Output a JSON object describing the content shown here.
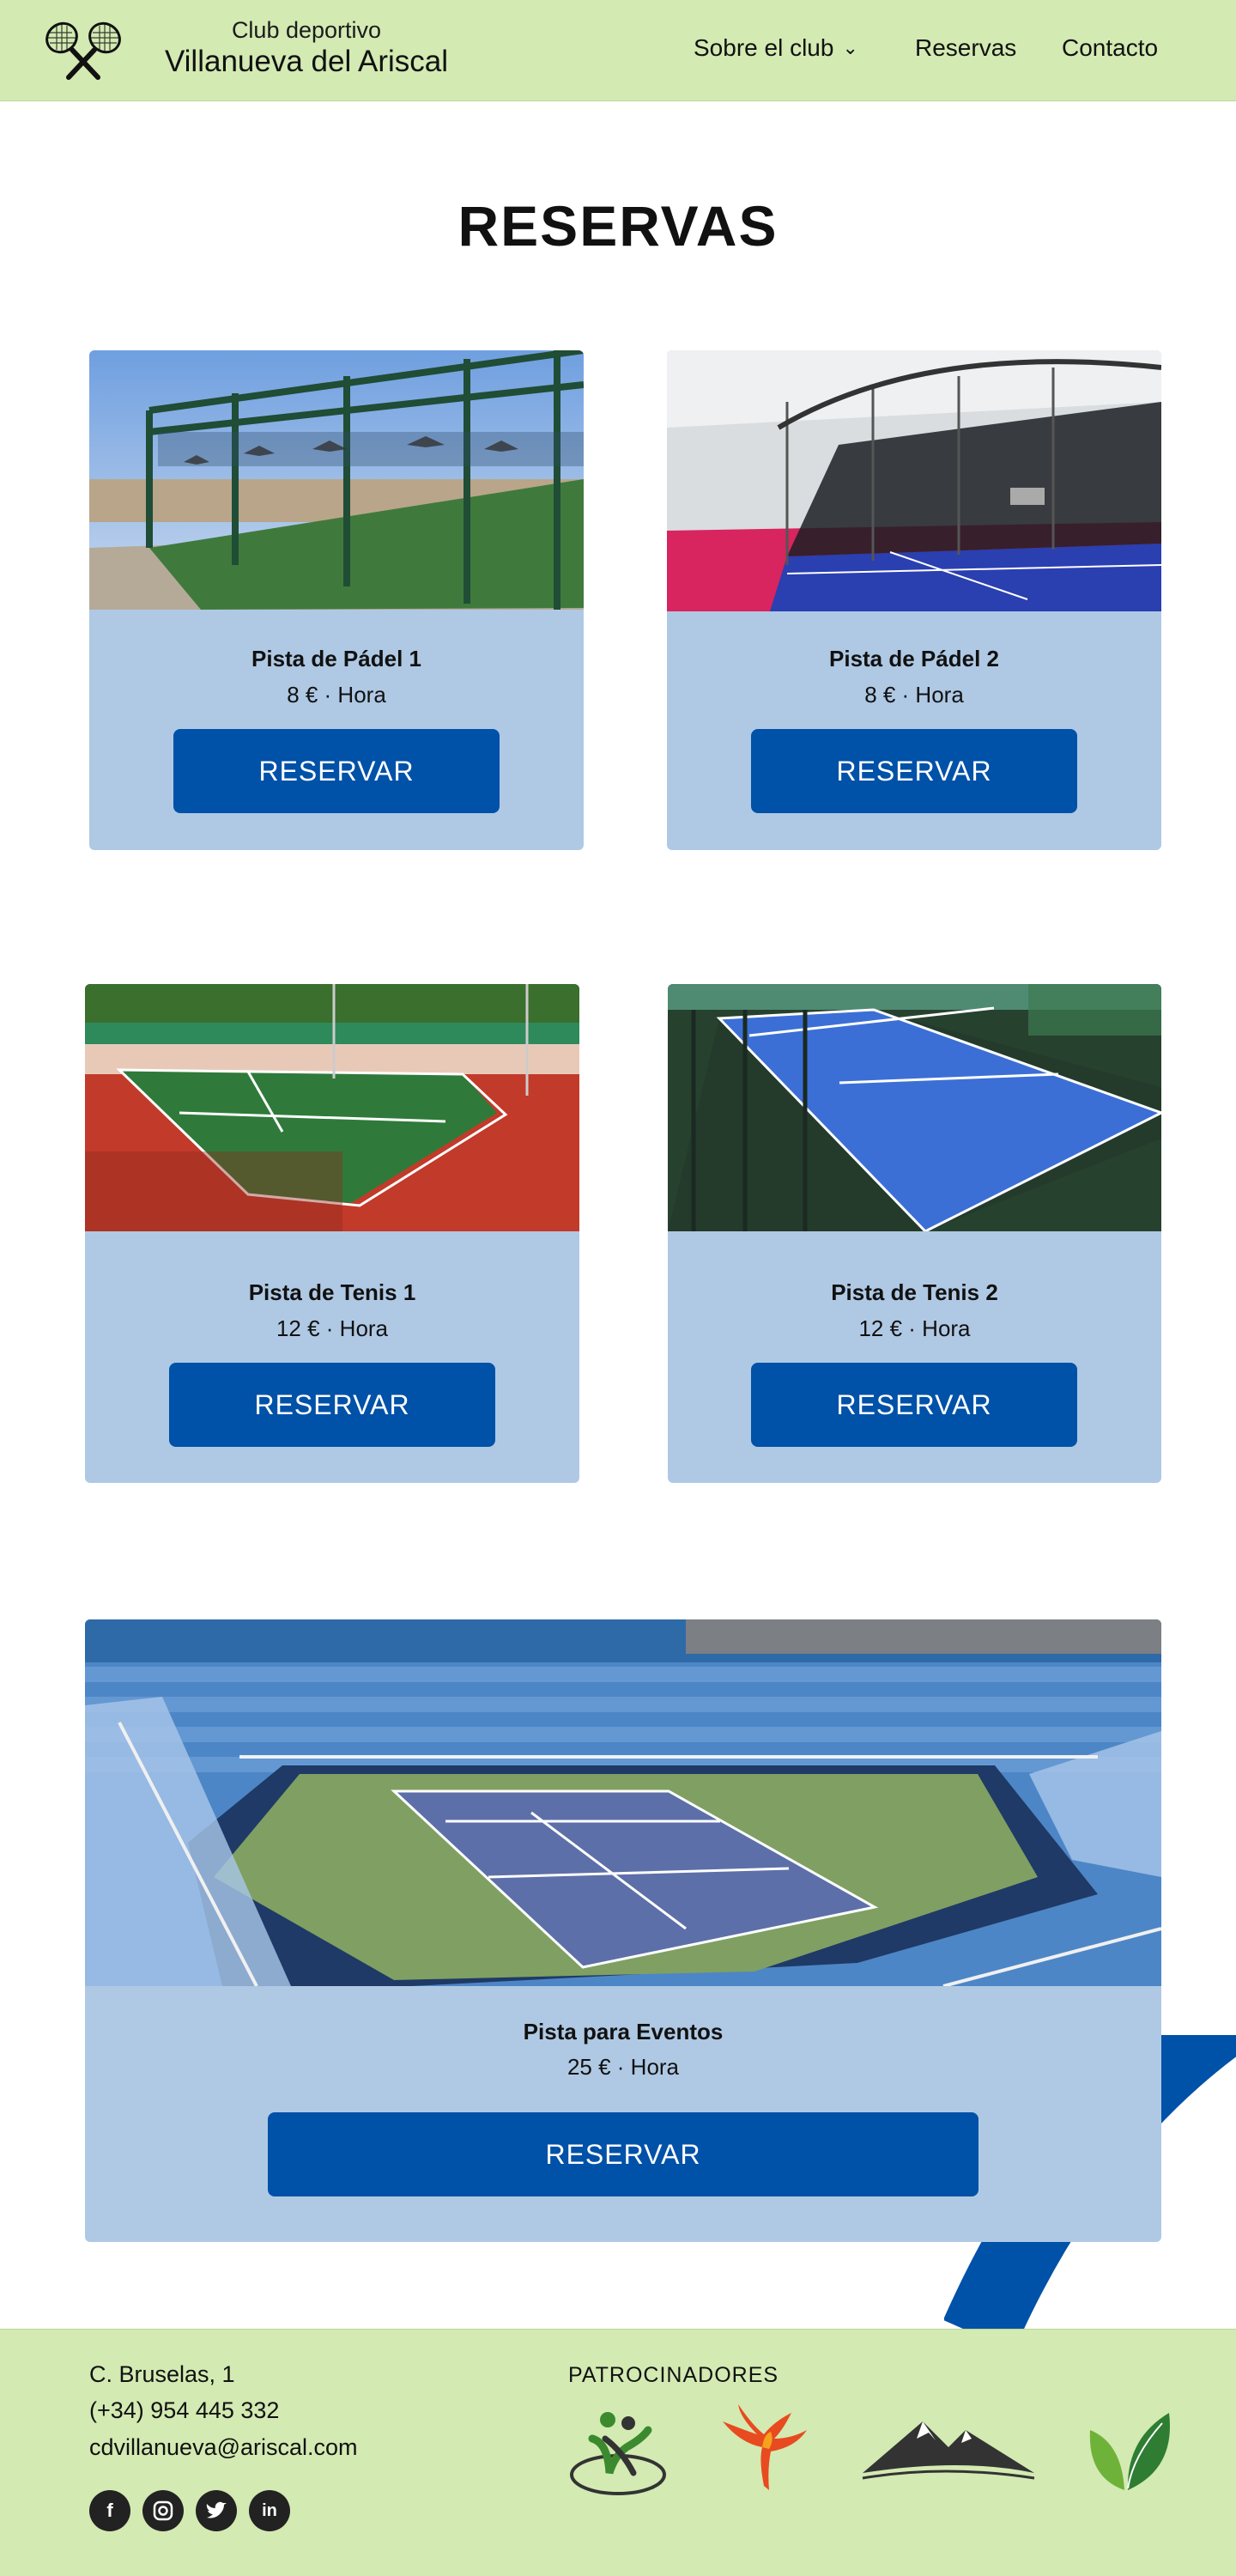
{
  "header": {
    "brand_line1": "Club deportivo",
    "brand_line2": "Villanueva del Ariscal",
    "logo_icon": "crossed-tennis-rackets-icon",
    "nav": {
      "about": "Sobre el club",
      "reservas": "Reservas",
      "contacto": "Contacto"
    },
    "bg_color": "#d3eab2"
  },
  "main": {
    "title": "RESERVAS",
    "courts": [
      {
        "name": "Pista de Pádel 1",
        "price": "8 € · Hora",
        "button": "RESERVAR"
      },
      {
        "name": "Pista de Pádel 2",
        "price": "8 € · Hora",
        "button": "RESERVAR"
      },
      {
        "name": "Pista de Tenis 1",
        "price": "12 € · Hora",
        "button": "RESERVAR"
      },
      {
        "name": "Pista de Tenis 2",
        "price": "12 € · Hora",
        "button": "RESERVAR"
      },
      {
        "name": "Pista para Eventos",
        "price": "25 € · Hora",
        "button": "RESERVAR"
      }
    ],
    "card_color": "#afc9e4",
    "button_color": "#0051a8"
  },
  "footer": {
    "address": "C. Bruselas, 1",
    "phone": "(+34) 954 445 332",
    "email": "cdvillanueva@ariscal.com",
    "social_icons": [
      "facebook-icon",
      "instagram-icon",
      "twitter-icon",
      "linkedin-icon"
    ],
    "sponsors_title": "PATROCINADORES",
    "sponsor_icons": [
      "people-logo-icon",
      "phoenix-logo-icon",
      "mountains-logo-icon",
      "leaves-logo-icon"
    ]
  }
}
